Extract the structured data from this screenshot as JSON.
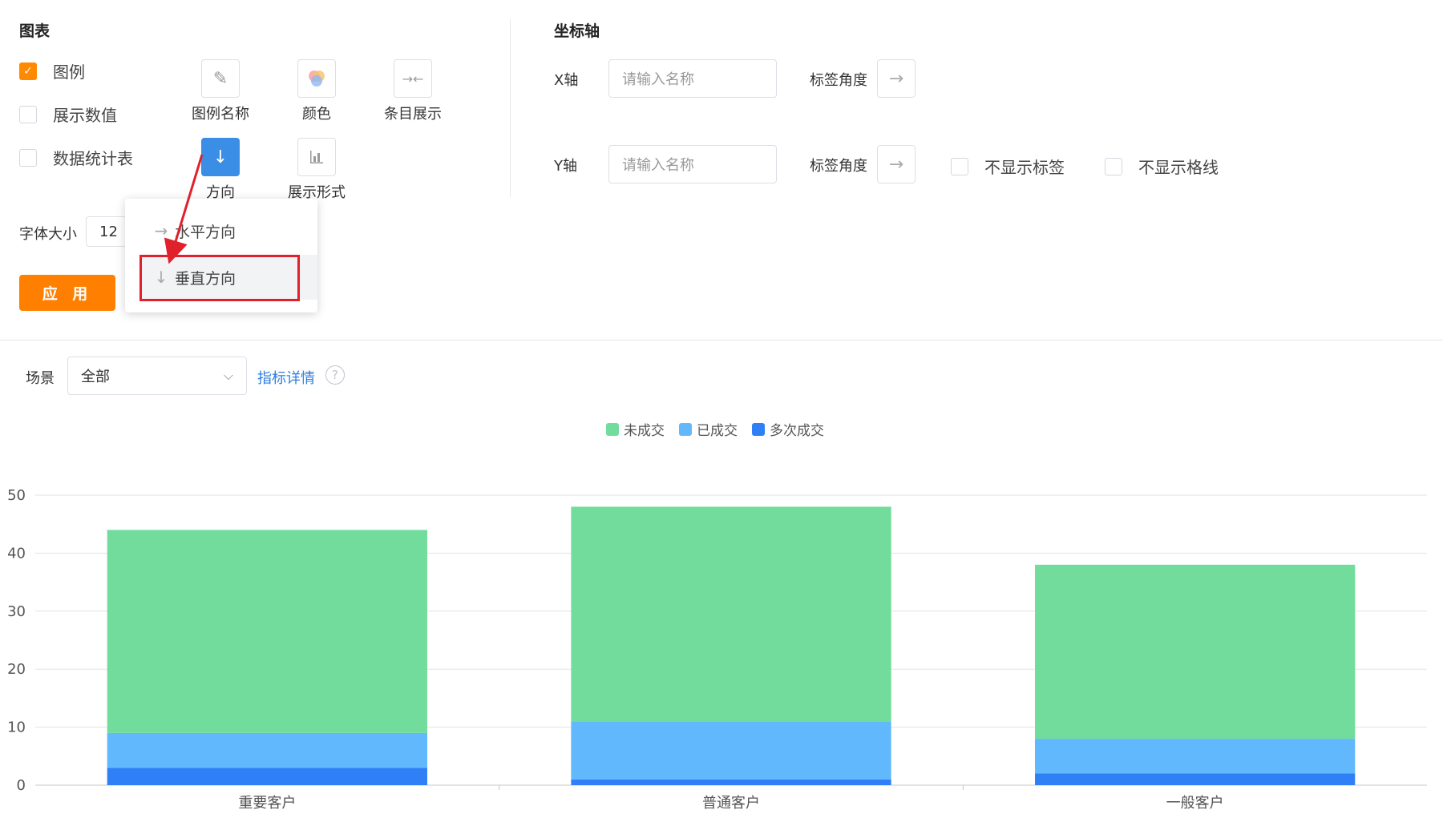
{
  "chart_panel": {
    "title": "图表",
    "options": [
      {
        "label": "图例",
        "checked": true
      },
      {
        "label": "展示数值",
        "checked": false
      },
      {
        "label": "数据统计表",
        "checked": false
      }
    ],
    "icon_buttons": [
      {
        "caption": "图例名称",
        "icon": "pencil-icon"
      },
      {
        "caption": "颜色",
        "icon": "color-palette-icon"
      },
      {
        "caption": "条目展示",
        "icon": "collapse-arrows-icon"
      },
      {
        "caption": "方向",
        "icon": "arrow-down-icon"
      },
      {
        "caption": "展示形式",
        "icon": "bar-chart-icon"
      }
    ],
    "font_size_label": "字体大小",
    "font_size_value": "12",
    "apply_label": "应 用"
  },
  "direction_dropdown": {
    "items": [
      {
        "label": "水平方向",
        "icon": "arrow-right-icon"
      },
      {
        "label": "垂直方向",
        "icon": "arrow-down-icon"
      }
    ]
  },
  "axis_panel": {
    "title": "坐标轴",
    "x_label": "X轴",
    "y_label": "Y轴",
    "x_placeholder": "请输入名称",
    "y_placeholder": "请输入名称",
    "angle_label": "标签角度",
    "hide_label": "不显示标签",
    "hide_grid": "不显示格线"
  },
  "filter": {
    "scene_label": "场景",
    "scene_value": "全部",
    "detail_link": "指标详情",
    "help_symbol": "?"
  },
  "chart_data": {
    "type": "bar",
    "stacked": true,
    "categories": [
      "重要客户",
      "普通客户",
      "一般客户"
    ],
    "series": [
      {
        "name": "多次成交",
        "color": "#2f80f7",
        "values": [
          3,
          1,
          2
        ]
      },
      {
        "name": "已成交",
        "color": "#62b8fc",
        "values": [
          6,
          10,
          6
        ]
      },
      {
        "name": "未成交",
        "color": "#72dc9c",
        "values": [
          35,
          37,
          30
        ]
      }
    ],
    "legend_order": [
      "未成交",
      "已成交",
      "多次成交"
    ],
    "ylim": [
      0,
      50
    ],
    "yticks": [
      0,
      10,
      20,
      30,
      40,
      50
    ],
    "grid": true,
    "legend_position": "top-center"
  }
}
